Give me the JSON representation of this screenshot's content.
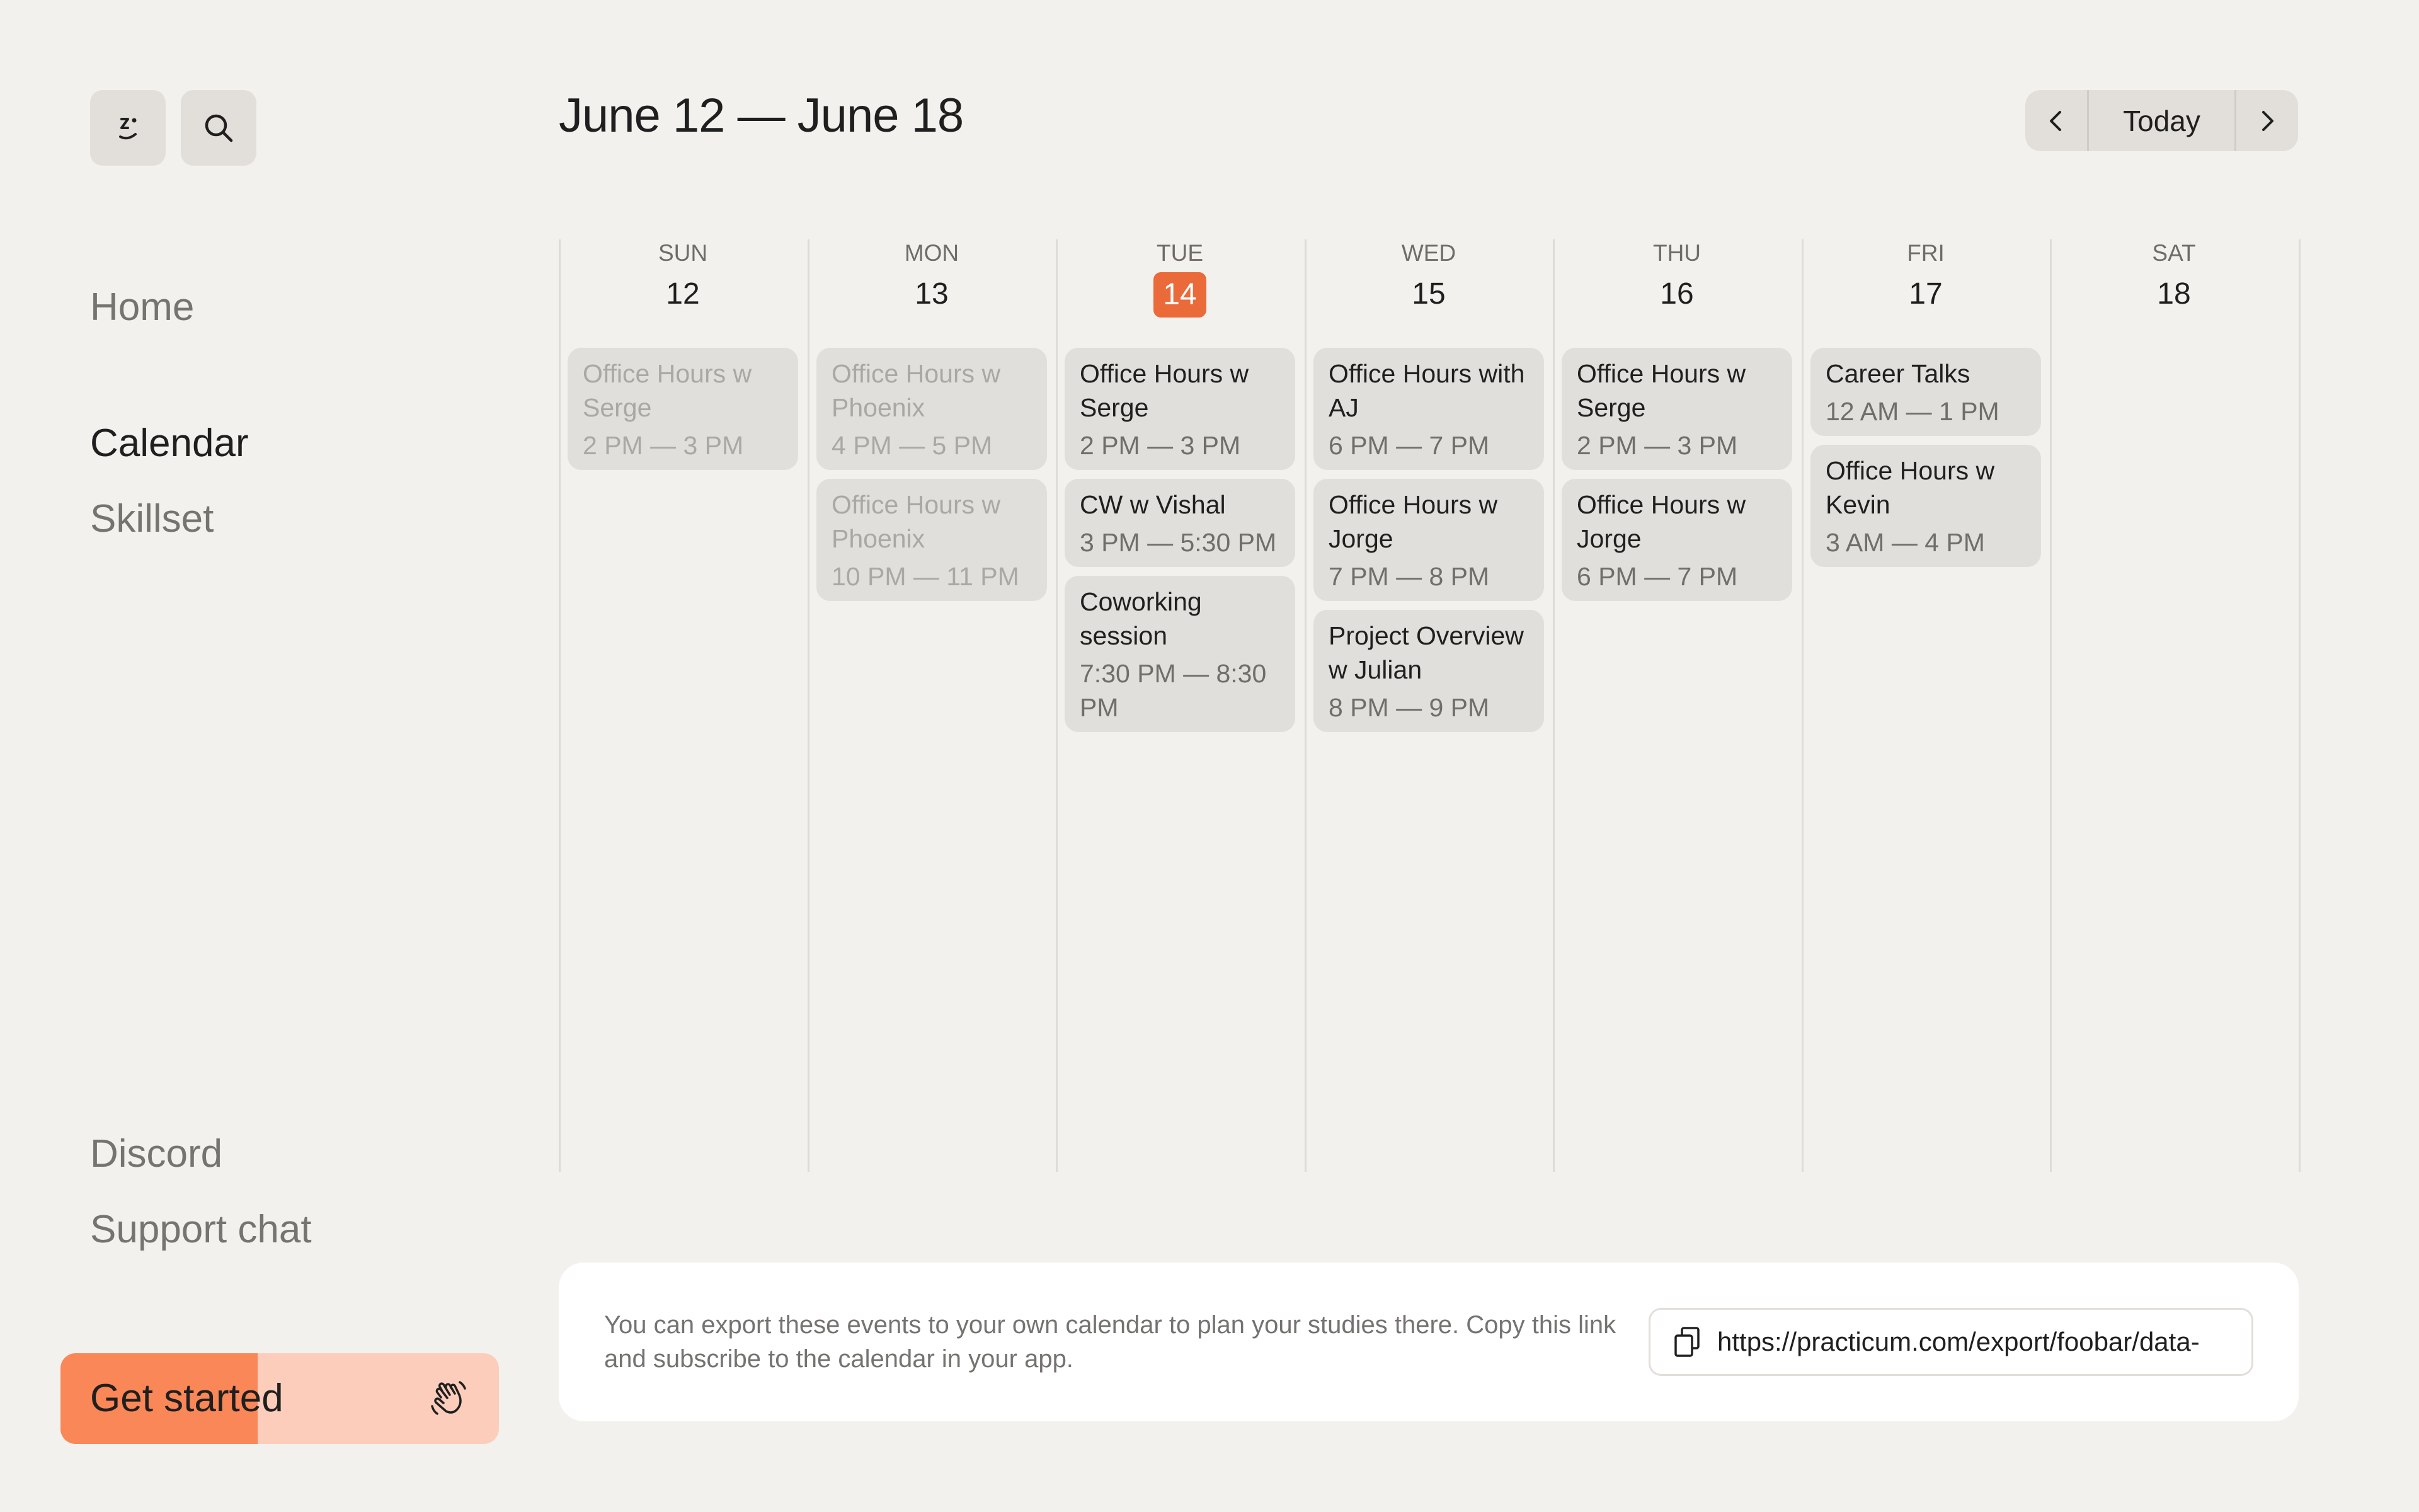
{
  "sidebar": {
    "logo_icon": "face-logo-icon",
    "search_icon": "search-icon",
    "nav": {
      "home": "Home",
      "calendar": "Calendar",
      "skillset": "Skillset",
      "discord": "Discord",
      "support": "Support chat"
    },
    "get_started": {
      "label": "Get started",
      "progress_fraction": 0.45,
      "icon": "waving-hand-icon"
    }
  },
  "header": {
    "title": "June 12 — June 18",
    "today_label": "Today",
    "prev_icon": "chevron-left-icon",
    "next_icon": "chevron-right-icon"
  },
  "colors": {
    "accent": "#eb6a3a",
    "background": "#f3f1ee",
    "event_bg": "#e0dfdb"
  },
  "days": [
    {
      "dow": "SUN",
      "num": "12",
      "is_today": false,
      "events": [
        {
          "title": "Office Hours w Serge",
          "time": "2 PM — 3 PM",
          "past": true
        }
      ]
    },
    {
      "dow": "MON",
      "num": "13",
      "is_today": false,
      "events": [
        {
          "title": "Office Hours w Phoenix",
          "time": "4 PM — 5 PM",
          "past": true
        },
        {
          "title": "Office Hours w Phoenix",
          "time": "10 PM — 11 PM",
          "past": true
        }
      ]
    },
    {
      "dow": "TUE",
      "num": "14",
      "is_today": true,
      "events": [
        {
          "title": "Office Hours w Serge",
          "time": "2 PM — 3 PM",
          "past": false
        },
        {
          "title": "CW w Vishal",
          "time": "3 PM — 5:30 PM",
          "past": false
        },
        {
          "title": "Coworking session",
          "time": "7:30 PM — 8:30 PM",
          "past": false
        }
      ]
    },
    {
      "dow": "WED",
      "num": "15",
      "is_today": false,
      "events": [
        {
          "title": "Office Hours with AJ",
          "time": "6 PM — 7 PM",
          "past": false
        },
        {
          "title": "Office Hours w Jorge",
          "time": "7 PM — 8 PM",
          "past": false
        },
        {
          "title": "Project Overview w Julian",
          "time": "8 PM — 9 PM",
          "past": false
        }
      ]
    },
    {
      "dow": "THU",
      "num": "16",
      "is_today": false,
      "events": [
        {
          "title": "Office Hours w Serge",
          "time": "2 PM — 3 PM",
          "past": false
        },
        {
          "title": "Office Hours w Jorge",
          "time": "6 PM — 7 PM",
          "past": false
        }
      ]
    },
    {
      "dow": "FRI",
      "num": "17",
      "is_today": false,
      "events": [
        {
          "title": "Career Talks",
          "time": "12 AM — 1 PM",
          "past": false
        },
        {
          "title": "Office Hours w Kevin",
          "time": "3 AM — 4 PM",
          "past": false
        }
      ]
    },
    {
      "dow": "SAT",
      "num": "18",
      "is_today": false,
      "events": []
    }
  ],
  "export": {
    "text": "You can export these events to your own calendar to plan your studies there. Copy this link and subscribe to the calendar in your app.",
    "url": "https://practicum.com/export/foobar/data-",
    "copy_icon": "copy-icon"
  }
}
